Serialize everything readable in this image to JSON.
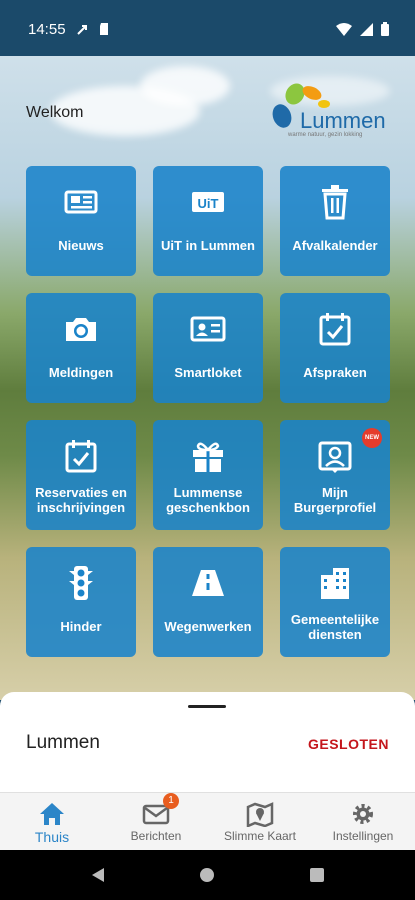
{
  "status_bar": {
    "time": "14:55"
  },
  "header": {
    "welcome": "Welkom",
    "logo_text": "Lummen",
    "logo_tagline": "warme natuur, gezin lokking"
  },
  "tiles": [
    {
      "label": "Nieuws",
      "icon": "newspaper-icon"
    },
    {
      "label": "UiT in Lummen",
      "icon": "uit-icon",
      "icon_text": "UiT"
    },
    {
      "label": "Afvalkalender",
      "icon": "trash-icon"
    },
    {
      "label": "Meldingen",
      "icon": "camera-icon"
    },
    {
      "label": "Smartloket",
      "icon": "id-card-icon"
    },
    {
      "label": "Afspraken",
      "icon": "calendar-check-icon"
    },
    {
      "label": "Reservaties en inschrijvingen",
      "icon": "calendar-check-icon"
    },
    {
      "label": "Lummense geschenkbon",
      "icon": "gift-icon"
    },
    {
      "label": "Mijn Burgerprofiel",
      "icon": "profile-icon",
      "badge": "NEW"
    },
    {
      "label": "Hinder",
      "icon": "traffic-light-icon"
    },
    {
      "label": "Wegenwerken",
      "icon": "road-icon"
    },
    {
      "label": "Gemeentelijke diensten",
      "icon": "buildings-icon"
    }
  ],
  "sheet": {
    "location": "Lummen",
    "status": "GESLOTEN"
  },
  "tabs": [
    {
      "label": "Thuis",
      "icon": "home-icon",
      "active": true
    },
    {
      "label": "Berichten",
      "icon": "mail-icon",
      "badge": "1"
    },
    {
      "label": "Slimme Kaart",
      "icon": "map-icon"
    },
    {
      "label": "Instellingen",
      "icon": "gear-icon"
    }
  ],
  "colors": {
    "tile": "#1a83c9",
    "accent": "#2b85c8",
    "status_closed": "#c4161c",
    "badge": "#e85d1f",
    "statusbar": "#1b4a6a"
  }
}
